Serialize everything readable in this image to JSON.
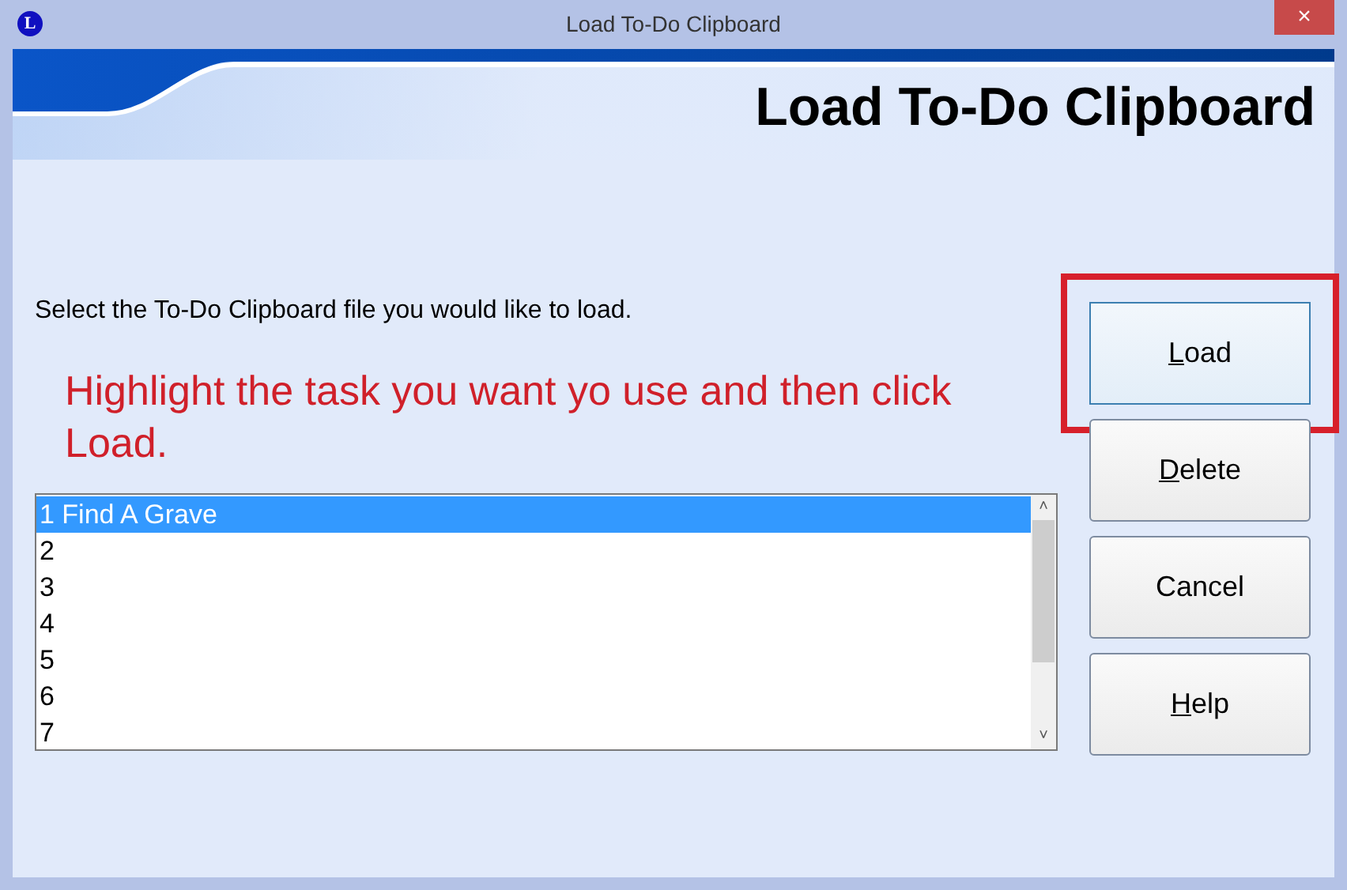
{
  "window": {
    "title": "Load To-Do Clipboard",
    "app_icon": "L",
    "close": "×"
  },
  "banner": {
    "heading": "Load To-Do Clipboard"
  },
  "prompt": "Select the To-Do Clipboard file you would like to load.",
  "instruction": "Highlight the task you want yo use and then click Load.",
  "list": {
    "items": [
      {
        "label": "1 Find A Grave",
        "selected": true
      },
      {
        "label": "2",
        "selected": false
      },
      {
        "label": "3",
        "selected": false
      },
      {
        "label": "4",
        "selected": false
      },
      {
        "label": "5",
        "selected": false
      },
      {
        "label": "6",
        "selected": false
      },
      {
        "label": "7",
        "selected": false
      }
    ],
    "scroll_up": "˄",
    "scroll_down": "˅"
  },
  "buttons": [
    {
      "label": "Load",
      "first_letter_underlined": true,
      "highlighted": true
    },
    {
      "label": "Delete",
      "first_letter_underlined": true,
      "highlighted": false
    },
    {
      "label": "Cancel",
      "first_letter_underlined": false,
      "highlighted": false
    },
    {
      "label": "Help",
      "first_letter_underlined": true,
      "highlighted": false
    }
  ]
}
